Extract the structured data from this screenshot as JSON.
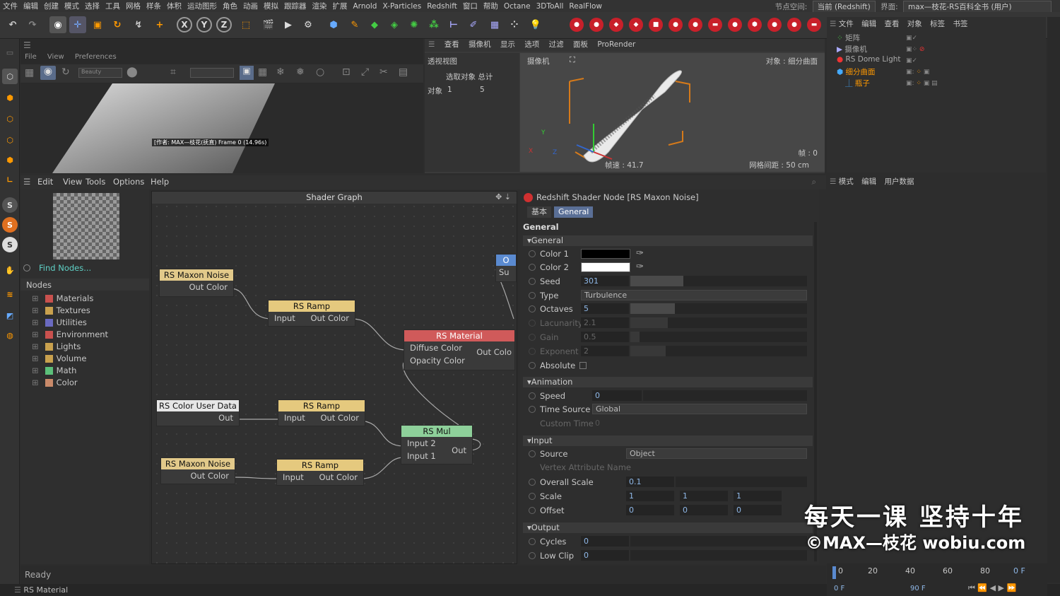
{
  "menubar": {
    "items": [
      "文件",
      "编辑",
      "创建",
      "模式",
      "选择",
      "工具",
      "网格",
      "样条",
      "体积",
      "运动图形",
      "角色",
      "动画",
      "模拟",
      "跟踪器",
      "渲染",
      "扩展",
      "Arnold",
      "X-Particles",
      "Redshift",
      "窗口",
      "帮助",
      "Octane",
      "3DToAll",
      "RealFlow"
    ],
    "node_space_label": "节点空间:",
    "node_space_value": "当前 (Redshift)",
    "layout_label": "界面:",
    "layout_value": "max—枝花-RS百科全书 (用户)"
  },
  "rsview": {
    "menu": [
      "File",
      "View",
      "Preferences"
    ],
    "beauty": "Beauty",
    "render_label": "[作者: MAX—枝花(抚直)  Frame  0 (14.96s)"
  },
  "viewport": {
    "menu": [
      "查看",
      "摄像机",
      "显示",
      "选项",
      "过滤",
      "面板",
      "ProRender"
    ],
    "view_name": "透视视图",
    "camera": "摄像机",
    "selected_total": "选取对象 总计",
    "objects_label": "对象",
    "objects_selected": "1",
    "objects_total": "5",
    "object_info": "对象 : 细分曲面",
    "frame": "帧 : 0",
    "speed": "帧速 : 41.7",
    "grid": "网格间距 : 50 cm",
    "axis_y": "Y",
    "axis_x": "X",
    "axis_z": "Z"
  },
  "objmgr": {
    "menu": [
      "文件",
      "编辑",
      "查看",
      "对象",
      "标签",
      "书签"
    ],
    "objects": [
      "矩阵",
      "摄像机",
      "RS Dome Light",
      "细分曲面",
      "瓶子"
    ]
  },
  "attrmgr": {
    "menu": [
      "模式",
      "编辑",
      "用户数据"
    ]
  },
  "nodegraph": {
    "menu": [
      "Edit",
      "View",
      "Tools",
      "Options",
      "Help"
    ],
    "title": "Shader Graph",
    "find_nodes": "Find Nodes...",
    "nodes_header": "Nodes",
    "categories": [
      "Materials",
      "Textures",
      "Utilities",
      "Environment",
      "Lights",
      "Volume",
      "Math",
      "Color"
    ],
    "nodes": {
      "noise1": {
        "title": "RS Maxon Noise",
        "out": "Out Color"
      },
      "ramp1": {
        "title": "RS Ramp",
        "in": "Input",
        "out": "Out Color"
      },
      "material": {
        "title": "RS Material",
        "in1": "Diffuse Color",
        "in2": "Opacity Color",
        "out": "Out Colo"
      },
      "out": {
        "title": "O",
        "in": "Su"
      },
      "cud": {
        "title": "RS Color User Data",
        "out": "Out"
      },
      "ramp2": {
        "title": "RS Ramp",
        "in": "Input",
        "out": "Out Color"
      },
      "mul": {
        "title": "RS Mul",
        "in1": "Input 2",
        "in2": "Input 1",
        "out": "Out"
      },
      "noise2": {
        "title": "RS Maxon Noise",
        "out": "Out Color"
      },
      "ramp3": {
        "title": "RS Ramp",
        "in": "Input",
        "out": "Out Color"
      }
    }
  },
  "props": {
    "title": "Redshift Shader Node [RS Maxon Noise]",
    "tab_basic": "基本",
    "tab_general": "General",
    "group_title": "General",
    "sections": {
      "general": "General",
      "animation": "Animation",
      "input": "Input",
      "output": "Output"
    },
    "color1": "Color 1",
    "color2": "Color 2",
    "seed": "Seed",
    "seed_val": "301",
    "type": "Type",
    "type_val": "Turbulence",
    "octaves": "Octaves",
    "octaves_val": "5",
    "lacunarity": "Lacunarity",
    "lacunarity_val": "2.1",
    "gain": "Gain",
    "gain_val": "0.5",
    "exponent": "Exponent",
    "exponent_val": "2",
    "absolute": "Absolute",
    "speed": "Speed",
    "speed_val": "0",
    "time_source": "Time Source",
    "time_source_val": "Global",
    "custom_time": "Custom Time",
    "custom_time_val": "0",
    "source": "Source",
    "source_val": "Object",
    "vertex_attr": "Vertex Attribute Name",
    "overall_scale": "Overall Scale",
    "overall_scale_val": "0.1",
    "scale": "Scale",
    "scale_x": "1",
    "scale_y": "1",
    "scale_z": "1",
    "offset": "Offset",
    "offset_x": "0",
    "offset_y": "0",
    "offset_z": "0",
    "cycles": "Cycles",
    "cycles_val": "0",
    "low_clip": "Low Clip",
    "low_clip_val": "0"
  },
  "status": {
    "text": "Ready",
    "bottom": "RS Material"
  },
  "timeline": {
    "ticks": [
      "0",
      "20",
      "40",
      "60",
      "80"
    ],
    "current": "0 F",
    "start": "0 F",
    "end": "90 F"
  },
  "watermark": {
    "line1": "每天一课 坚持十年",
    "line2": "©MAX—枝花 wobiu.com"
  }
}
